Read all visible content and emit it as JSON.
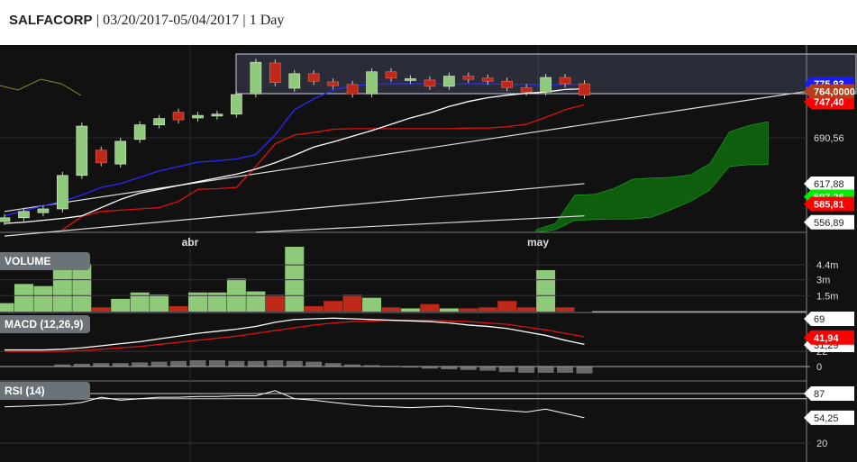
{
  "header": {
    "symbol": "SALFACORP",
    "sep1": "|",
    "range": "03/20/2017-05/04/2017",
    "sep2": "|",
    "interval": "1 Day"
  },
  "colors": {
    "background": "#111111",
    "up": "#8fc97a",
    "down": "#c0281a",
    "ma_fast": "#2a2aff",
    "ma_slow": "#ffffff",
    "ma_red": "#e01010",
    "cloud": "#0e5e0e",
    "last_price": "#b83c18"
  },
  "chart_data": {
    "type": "candlestick",
    "x_labels": [
      {
        "label": "abr",
        "index": 9.6
      },
      {
        "label": "may",
        "index": 27.6
      }
    ],
    "candles": [
      {
        "o": 558,
        "c": 564
      },
      {
        "o": 564,
        "c": 574
      },
      {
        "o": 572,
        "c": 578
      },
      {
        "o": 578,
        "c": 631
      },
      {
        "o": 631,
        "c": 709
      },
      {
        "o": 671,
        "c": 651
      },
      {
        "o": 649,
        "c": 685
      },
      {
        "o": 688,
        "c": 711
      },
      {
        "o": 711,
        "c": 721
      },
      {
        "o": 731,
        "c": 719
      },
      {
        "o": 722,
        "c": 726
      },
      {
        "o": 725,
        "c": 728
      },
      {
        "o": 728,
        "c": 759
      },
      {
        "o": 760,
        "c": 810
      },
      {
        "o": 809,
        "c": 778
      },
      {
        "o": 769,
        "c": 792
      },
      {
        "o": 792,
        "c": 780
      },
      {
        "o": 779,
        "c": 773
      },
      {
        "o": 775,
        "c": 760
      },
      {
        "o": 760,
        "c": 795
      },
      {
        "o": 795,
        "c": 785
      },
      {
        "o": 782,
        "c": 784
      },
      {
        "o": 782,
        "c": 772
      },
      {
        "o": 772,
        "c": 788
      },
      {
        "o": 788,
        "c": 783
      },
      {
        "o": 785,
        "c": 780
      },
      {
        "o": 780,
        "c": 770
      },
      {
        "o": 770,
        "c": 763
      },
      {
        "o": 763,
        "c": 786
      },
      {
        "o": 786,
        "c": 776
      },
      {
        "o": 776,
        "c": 758
      }
    ],
    "ma_blue": [
      567,
      575,
      583,
      590,
      600,
      612,
      618,
      628,
      638,
      645,
      652,
      654,
      657,
      664,
      695,
      735,
      752,
      766,
      773,
      775,
      776,
      776,
      776,
      775,
      776,
      776,
      775,
      775,
      774,
      775,
      775
    ],
    "ma_white": [
      555,
      557,
      560,
      563,
      567,
      580,
      593,
      603,
      609,
      615,
      621,
      627,
      633,
      641,
      651,
      663,
      676,
      684,
      693,
      702,
      712,
      722,
      730,
      740,
      748,
      754,
      758,
      761,
      763,
      767,
      768
    ],
    "ma_red": [
      null,
      null,
      null,
      545,
      566,
      574,
      576,
      578,
      580,
      590,
      609,
      610,
      612,
      645,
      681,
      695,
      699,
      704,
      705,
      705,
      705,
      705,
      705,
      705,
      706,
      706,
      708,
      712,
      723,
      735,
      743
    ],
    "cloud": {
      "start_index": 27.5,
      "upper": [
        545,
        555,
        600,
        601,
        610,
        625,
        627,
        628,
        632,
        650,
        700,
        710,
        716
      ],
      "lower": [
        541,
        545,
        560,
        561,
        562,
        562,
        565,
        577,
        590,
        608,
        645,
        648,
        648
      ]
    },
    "trendlines": [
      {
        "i0": 0,
        "p0": 574,
        "i1": 41.5,
        "p1": 764
      },
      {
        "i0": 0,
        "p0": 535,
        "i1": 30,
        "p1": 618
      },
      {
        "i0": 13,
        "p0": 541,
        "i1": 30,
        "p1": 567
      }
    ],
    "price_labels": [
      {
        "text": "775,93",
        "value": 775.93,
        "bg": "#1a1aff",
        "fg": "#ffffff"
      },
      {
        "text": "747,40",
        "value": 747.4,
        "bg": "#ff0000",
        "fg": "#ffffff"
      },
      {
        "text": "764,0000",
        "value": 764.0,
        "bg": "#b83c18",
        "fg": "#ffffff"
      },
      {
        "text": "690,56",
        "value": 690.56,
        "bg": "none",
        "fg": "#dddddd"
      },
      {
        "text": "617,88",
        "value": 617.88,
        "bg": "#ffffff",
        "fg": "#222222"
      },
      {
        "text": "597,26",
        "value": 597.26,
        "bg": "#00ee00",
        "fg": "#ffffff"
      },
      {
        "text": "585,81",
        "value": 585.81,
        "bg": "#ff0000",
        "fg": "#ffffff"
      },
      {
        "text": "556,89",
        "value": 556.89,
        "bg": "#ffffff",
        "fg": "#222222"
      }
    ],
    "volume": {
      "title": "VOLUME",
      "unit": "m",
      "values": [
        0.8,
        2.6,
        2.4,
        4.2,
        4.5,
        0.4,
        1.2,
        1.8,
        1.6,
        0.5,
        1.8,
        1.8,
        3.1,
        1.9,
        1.6,
        6.1,
        0.5,
        1.0,
        1.6,
        1.3,
        0.4,
        0.3,
        0.7,
        0.3,
        0.3,
        0.4,
        1.0,
        0.4,
        3.9,
        0.4
      ],
      "ticks": [
        {
          "text": "4.4m",
          "value": 4.4
        },
        {
          "text": "3m",
          "value": 3
        },
        {
          "text": "1.5m",
          "value": 1.5
        }
      ]
    },
    "macd": {
      "title": "MACD (12,26,9)",
      "macd": [
        24,
        24,
        24,
        25,
        27,
        30,
        33,
        36,
        40,
        44,
        48,
        51,
        54,
        58,
        64,
        68,
        69,
        70,
        69,
        68,
        67,
        66,
        65,
        63,
        60,
        58,
        55,
        50,
        45,
        38,
        32
      ],
      "signal": [
        22,
        22,
        22,
        22,
        23,
        25,
        27,
        29,
        32,
        35,
        38,
        41,
        44,
        48,
        52,
        56,
        60,
        63,
        65,
        66,
        67,
        67,
        67,
        66,
        65,
        63,
        61,
        57,
        53,
        48,
        43
      ],
      "hist": [
        null,
        null,
        null,
        3,
        4,
        5,
        5,
        6,
        7,
        8,
        9,
        9,
        8,
        8,
        9,
        8,
        7,
        5,
        3,
        2,
        1,
        0,
        -3,
        -4,
        -5,
        -6,
        -8,
        -9,
        -9,
        -9,
        -10
      ],
      "ticks": [
        {
          "text": "22",
          "value": 22
        },
        {
          "text": "0",
          "value": 0
        }
      ],
      "labels": [
        {
          "text": "69",
          "value": 69,
          "bg": "#ffffff",
          "fg": "#222222"
        },
        {
          "text": "31,29",
          "value": 31.29,
          "bg": "#ffffff",
          "fg": "#222222"
        },
        {
          "text": "41,94",
          "value": 41.94,
          "bg": "#ff0000",
          "fg": "#ffffff"
        }
      ]
    },
    "rsi": {
      "title": "RSI (14)",
      "values": [
        69,
        70,
        71,
        72,
        75,
        82,
        78,
        80,
        82,
        82,
        83,
        83,
        84,
        84,
        91,
        80,
        78,
        75,
        72,
        70,
        69,
        68,
        69,
        70,
        68,
        66,
        64,
        62,
        66,
        60,
        54.25
      ],
      "bands": [
        87,
        80
      ],
      "ticks": [
        {
          "text": "20",
          "value": 20
        }
      ],
      "labels": [
        {
          "text": "87",
          "value": 87,
          "bg": "#ffffff",
          "fg": "#222222"
        },
        {
          "text": "54,25",
          "value": 54.25,
          "bg": "#ffffff",
          "fg": "#222222"
        }
      ]
    }
  }
}
